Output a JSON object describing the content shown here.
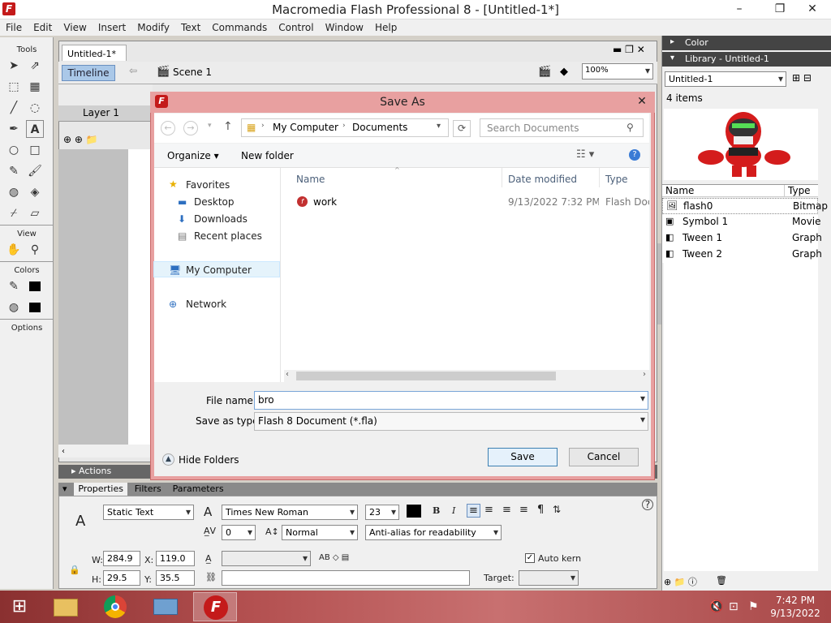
{
  "app": {
    "title": "Macromedia Flash Professional 8 - [Untitled-1*]",
    "icon": "F"
  },
  "menu": [
    "File",
    "Edit",
    "View",
    "Insert",
    "Modify",
    "Text",
    "Commands",
    "Control",
    "Window",
    "Help"
  ],
  "tools": {
    "header": "Tools",
    "view_header": "View",
    "colors_header": "Colors",
    "options_header": "Options"
  },
  "document": {
    "tab": "Untitled-1*",
    "timeline_label": "Timeline",
    "scene": "Scene 1",
    "zoom": "100%",
    "layer": "Layer 1",
    "actions_label": "Actions"
  },
  "properties": {
    "tabs": [
      "Properties",
      "Filters",
      "Parameters"
    ],
    "text_type": "Static Text",
    "font": "Times New Roman",
    "size": "23",
    "letter_spacing": "0",
    "position_mode": "Normal",
    "antialias": "Anti-alias for readability",
    "w_label": "W:",
    "w": "284.9",
    "h_label": "H:",
    "h": "29.5",
    "x_label": "X:",
    "x": "119.0",
    "y_label": "Y:",
    "y": "35.5",
    "auto_kern": "Auto kern",
    "target_label": "Target:"
  },
  "panels": {
    "color": "Color",
    "library": "Library - Untitled-1",
    "library_doc": "Untitled-1",
    "item_count": "4 items",
    "col_name": "Name",
    "col_type": "Type",
    "items": [
      {
        "name": "flash0",
        "type": "Bitmap"
      },
      {
        "name": "Symbol 1",
        "type": "Movie"
      },
      {
        "name": "Tween 1",
        "type": "Graph"
      },
      {
        "name": "Tween 2",
        "type": "Graph"
      }
    ]
  },
  "dialog": {
    "title": "Save As",
    "path": [
      "My Computer",
      "Documents"
    ],
    "search_placeholder": "Search Documents",
    "organize": "Organize",
    "new_folder": "New folder",
    "nav": {
      "favorites": "Favorites",
      "desktop": "Desktop",
      "downloads": "Downloads",
      "recent": "Recent places",
      "computer": "My Computer",
      "network": "Network"
    },
    "columns": {
      "name": "Name",
      "date": "Date modified",
      "type": "Type"
    },
    "files": [
      {
        "name": "work",
        "date": "9/13/2022 7:32 PM",
        "type": "Flash Docu"
      }
    ],
    "filename_label": "File name:",
    "filename": "bro",
    "filetype_label": "Save as type:",
    "filetype": "Flash 8 Document (*.fla)",
    "hide_folders": "Hide Folders",
    "save": "Save",
    "cancel": "Cancel"
  },
  "taskbar": {
    "time": "7:42 PM",
    "date": "9/13/2022"
  }
}
